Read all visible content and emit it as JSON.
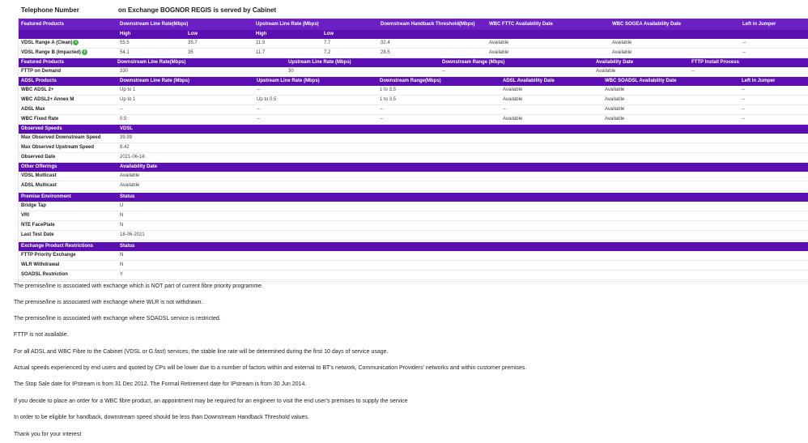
{
  "header": {
    "telephone_label": "Telephone Number",
    "exchange_label": "on Exchange BOGNOR REGIS is served by Cabinet"
  },
  "vdsl": {
    "h_featured": "Featured Products",
    "h_down": "Downstream Line Rate(Mbps)",
    "h_up": "Upstream Line Rate (Mbps)",
    "h_handback": "Downstream Handback Threshold(Mbps)",
    "h_fttc": "WBC FTTC Availability Date",
    "h_sogea": "WBC SOGEA Availability Date",
    "h_jumper": "Left in Jumper",
    "sub_high": "High",
    "sub_low": "Low",
    "sub_high2": "High",
    "sub_low2": "Low",
    "rows": [
      {
        "name": "VDSL Range A (Clean)",
        "dh": "55.5",
        "dl": "35.7",
        "uh": "11.9",
        "ul": "7.7",
        "hb": "32.4",
        "fttc": "Available",
        "sogea": "Available",
        "jumper": "--"
      },
      {
        "name": "VDSL Range B (Impacted)",
        "dh": "54.1",
        "dl": "35",
        "uh": "11.7",
        "ul": "7.2",
        "hb": "28.5",
        "fttc": "Available",
        "sogea": "Available",
        "jumper": "--"
      }
    ]
  },
  "fttp": {
    "h_featured": "Featured Products",
    "h_down": "Downstream Line Rate(Mbps)",
    "h_up": "Upstream Line Rate (Mbps)",
    "h_range": "Downstream Range (Mbps)",
    "h_avail": "Availability Date",
    "h_install": "FTTP Install Process",
    "row": {
      "name": "FTTP on Demand",
      "down": "330",
      "up": "30",
      "range": "--",
      "avail": "Available",
      "install": "--"
    }
  },
  "adsl": {
    "h_products": "ADSL Products",
    "h_down": "Downstream Line Rate (Mbps)",
    "h_up": "Upstream Line Rate (Mbps)",
    "h_range": "Downstream Range(Mbps)",
    "h_avail": "ADSL Availability Date",
    "h_sogea": "WBC SOADSL Availability Date",
    "h_jumper": "Left in Jumper",
    "rows": [
      {
        "name": "WBC ADSL 2+",
        "down": "Up to 1",
        "up": "--",
        "range": "1 to 3.5",
        "avail": "Available",
        "sogea": "Available",
        "jumper": "--"
      },
      {
        "name": "WBC ADSL2+ Annex M",
        "down": "Up to 1",
        "up": "Up to 0.5",
        "range": "1 to 3.5",
        "avail": "Available",
        "sogea": "Available",
        "jumper": "--"
      },
      {
        "name": "ADSL Max",
        "down": "--",
        "up": "--",
        "range": "--",
        "avail": "--",
        "sogea": "Available",
        "jumper": "--"
      },
      {
        "name": "WBC Fixed Rate",
        "down": "0.5",
        "up": "--",
        "range": "--",
        "avail": "Available",
        "sogea": "Available",
        "jumper": "--"
      }
    ]
  },
  "observed": {
    "h_title": "Observed Speeds",
    "h_value": "VDSL",
    "rows": [
      {
        "name": "Max Observed Downstream Speed",
        "value": "39.99"
      },
      {
        "name": "Max Observed Upstream Speed",
        "value": "8.42"
      },
      {
        "name": "Observed Date",
        "value": "2021-06-18"
      }
    ]
  },
  "other": {
    "h_title": "Other Offerings",
    "h_value": "Availability Date",
    "rows": [
      {
        "name": "VDSL Multicast",
        "value": "Available"
      },
      {
        "name": "ADSL Multicast",
        "value": "Available"
      }
    ]
  },
  "premise": {
    "h_title": "Premise Environment",
    "h_value": "Status",
    "rows": [
      {
        "name": "Bridge Tap",
        "value": "U"
      },
      {
        "name": "VRI",
        "value": "N"
      },
      {
        "name": "NTE FacePlate",
        "value": "N"
      },
      {
        "name": "Last Test Date",
        "value": "18-06-2021"
      }
    ]
  },
  "restrictions": {
    "h_title": "Exchange Product Restrictions",
    "h_value": "Status",
    "rows": [
      {
        "name": "FTTP Priority Exchange",
        "value": "N"
      },
      {
        "name": "WLR Withdrawal",
        "value": "N"
      },
      {
        "name": "SOADSL Restriction",
        "value": "Y"
      }
    ]
  },
  "notes": [
    "The premise/line is associated with exchange which is NOT part of current fibre priority programme.",
    "The premise/line is associated with exchange where WLR is not withdrawn.",
    "The premise/line is associated with exchange where SOADSL service is restricted.",
    "FTTP is not available.",
    "For all ADSL and WBC Fibre to the Cabinet (VDSL or G.fast) services, the stable line rate will be determined during the first 10 days of service usage.",
    "Actual speeds experienced by end users and quoted by CPs will be lower due to a number of factors within and external to BT's network, Communication Providers' networks and within customer premises.",
    "The Stop Sale date for IPstream is from 31 Dec 2012. The Formal Retirement date for IPstream is from 30 Jun 2014.",
    "If you decide to place an order for a WBC fibre product, an appointment may be required for an engineer to visit the end user's premises to supply the service",
    "In order to be eligible for handback, downstream speed should be less than Downstream Handback Threshold values.",
    "Thank you for your interest"
  ],
  "colors": {
    "header_bg": "#5b0fb3",
    "availability_icon": "#4caf50"
  }
}
